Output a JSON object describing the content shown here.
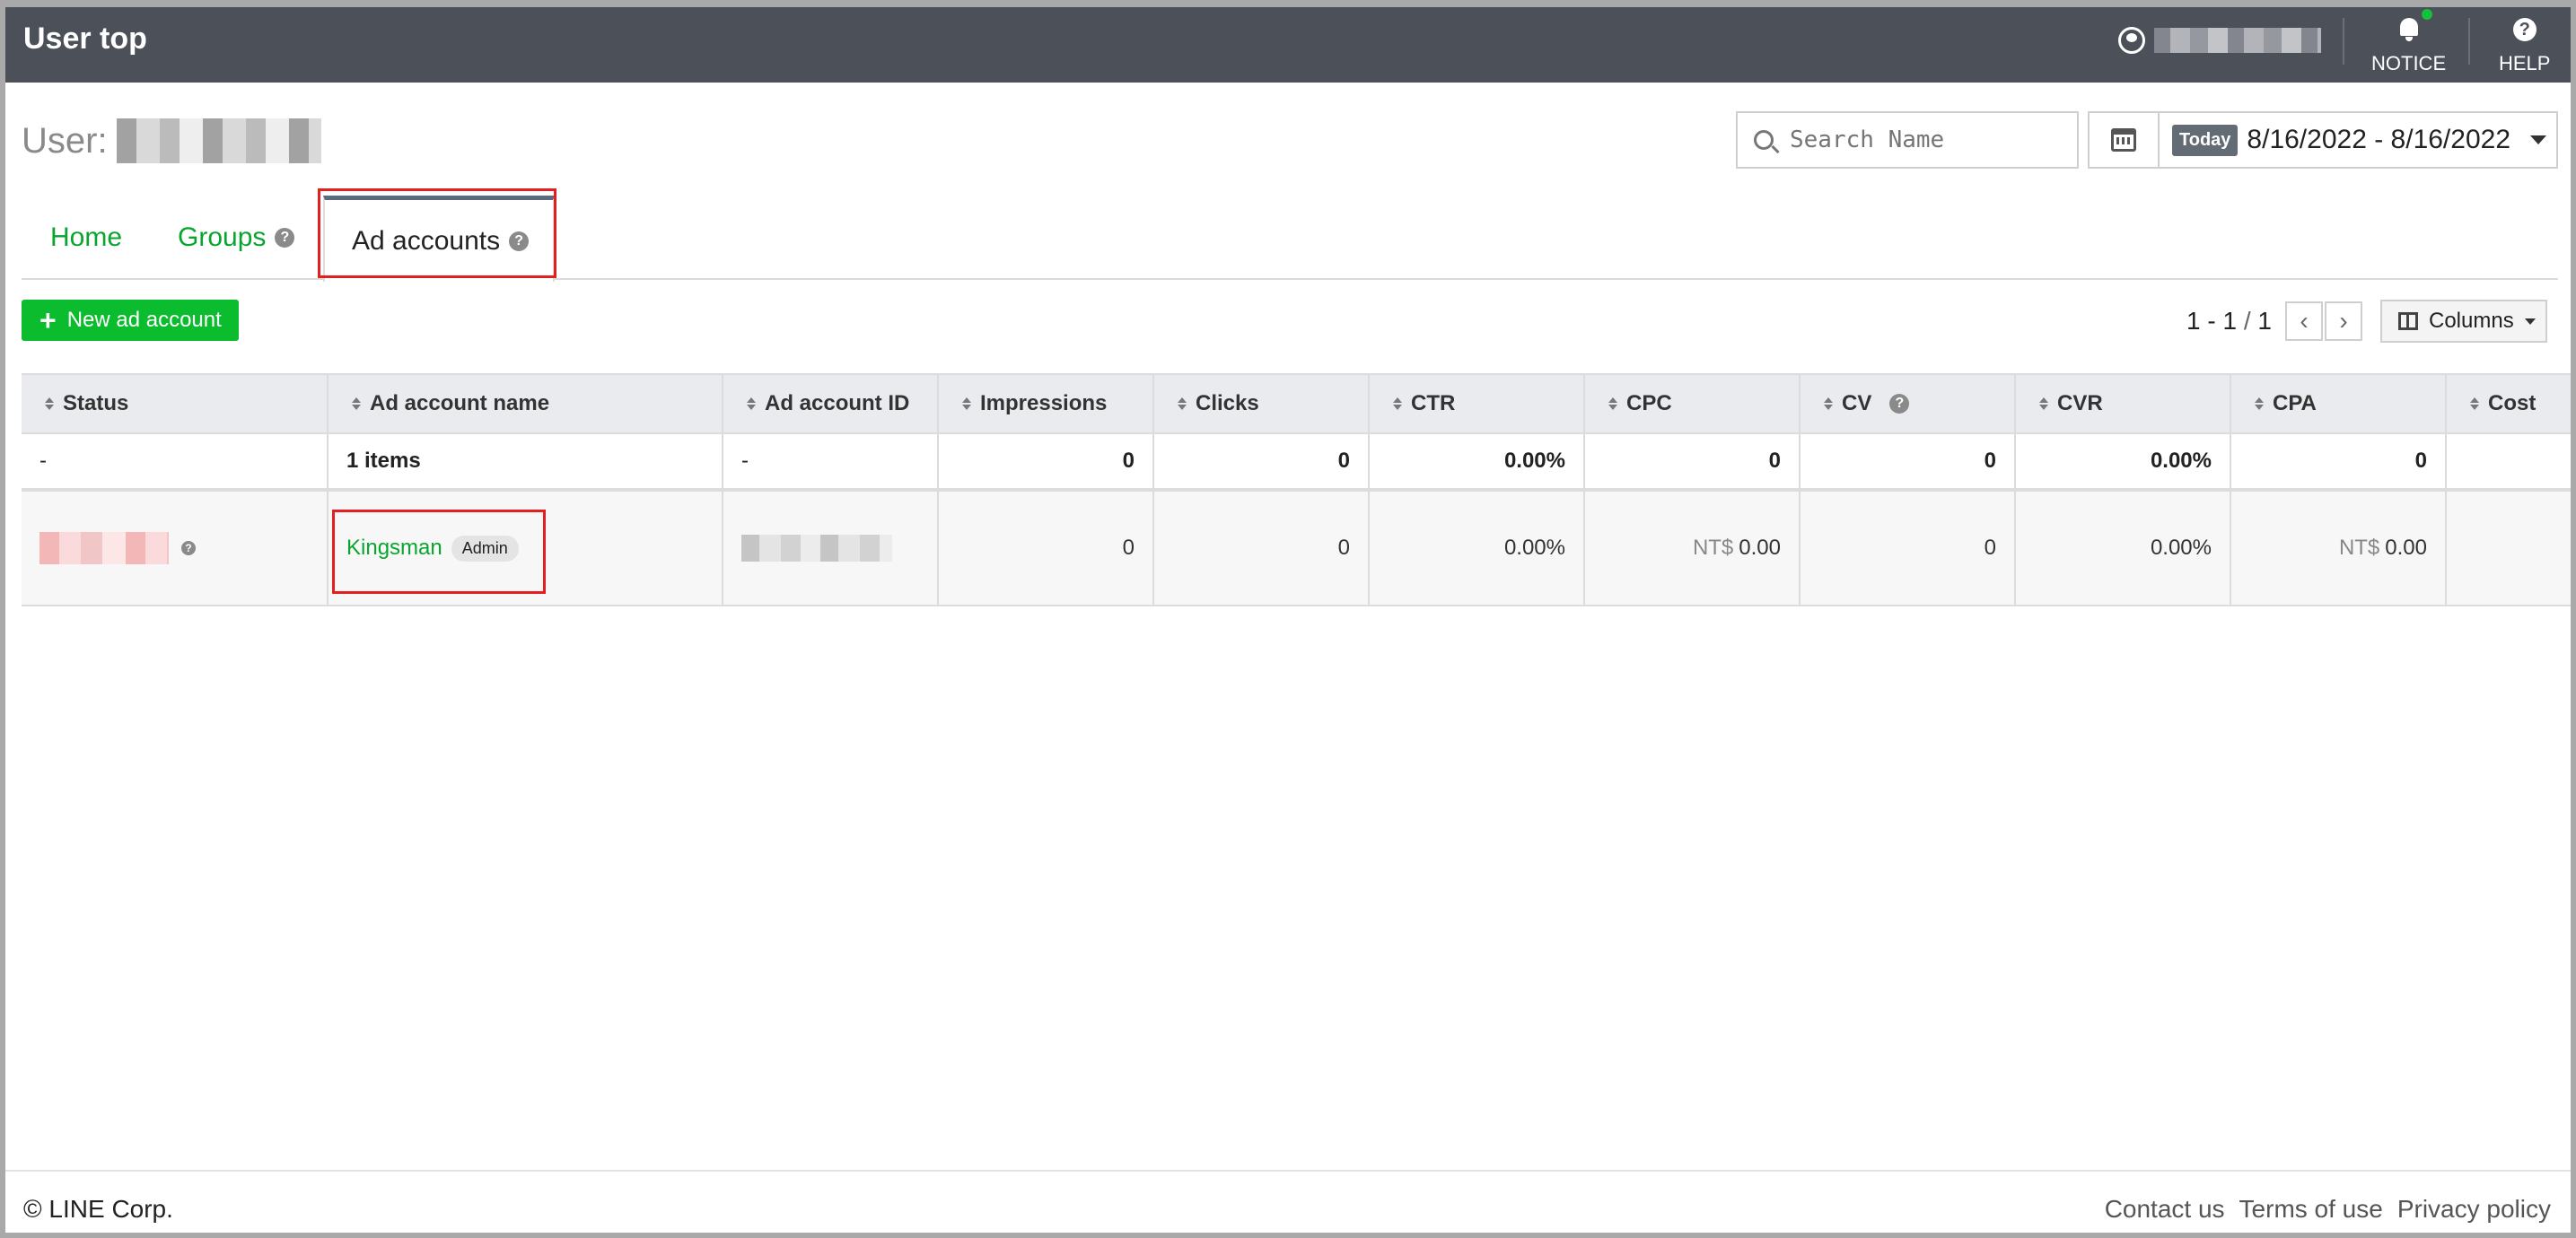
{
  "header": {
    "title": "User top",
    "notice_label": "NOTICE",
    "help_label": "HELP",
    "help_glyph": "?"
  },
  "user_label": "User:",
  "search": {
    "placeholder": "Search Name"
  },
  "date_filter": {
    "today_label": "Today",
    "range": "8/16/2022 - 8/16/2022"
  },
  "tabs": [
    {
      "label": "Home",
      "active": false
    },
    {
      "label": "Groups",
      "active": false
    },
    {
      "label": "Ad accounts",
      "active": true
    }
  ],
  "question_glyph": "?",
  "toolbar": {
    "new_button_icon": "+",
    "new_button_label": "New ad account",
    "pager_range": "1 - 1",
    "pager_sep": "/",
    "pager_total": "1",
    "prev_glyph": "‹",
    "next_glyph": "›",
    "columns_label": "Columns"
  },
  "table": {
    "columns": [
      "Status",
      "Ad account name",
      "Ad account ID",
      "Impressions",
      "Clicks",
      "CTR",
      "CPC",
      "CV",
      "CVR",
      "CPA",
      "Cost"
    ],
    "summary": {
      "status": "-",
      "name": "1 items",
      "id": "-",
      "impressions": "0",
      "clicks": "0",
      "ctr": "0.00%",
      "cpc": "0",
      "cv": "0",
      "cvr": "0.00%",
      "cpa": "0"
    },
    "rows": [
      {
        "account_name": "Kingsman",
        "role_badge": "Admin",
        "impressions": "0",
        "clicks": "0",
        "ctr": "0.00%",
        "cpc_currency": "NT$",
        "cpc_value": "0.00",
        "cv": "0",
        "cvr": "0.00%",
        "cpa_currency": "NT$",
        "cpa_value": "0.00"
      }
    ]
  },
  "footer": {
    "copyright": "© LINE Corp.",
    "links": [
      "Contact us",
      "Terms of use",
      "Privacy policy"
    ]
  },
  "colors": {
    "topbar": "#4b5059",
    "accent_green": "#09a52e",
    "button_green": "#0cbc2f",
    "highlight_red": "#e22020",
    "notice_dot": "#13c13e"
  }
}
